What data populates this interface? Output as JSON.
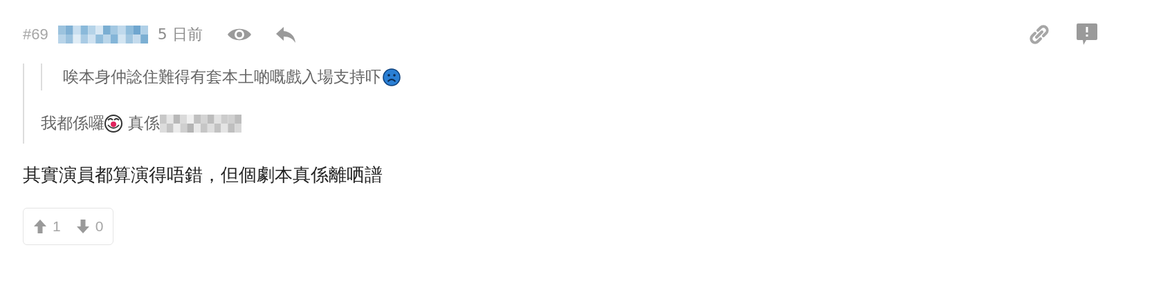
{
  "post": {
    "number": "#69",
    "time": "5 日前"
  },
  "quote": {
    "nested_quote": {
      "text": "唉本身仲諗住難得有套本土啲嘅戲入場支持吓"
    },
    "text_before": "我都係囉",
    "text_after": "真係"
  },
  "body": "其實演員都算演得唔錯，但個劇本真係離哂譜",
  "votes": [
    {
      "kind": "up",
      "count": "1"
    },
    {
      "kind": "down",
      "count": "0"
    }
  ]
}
